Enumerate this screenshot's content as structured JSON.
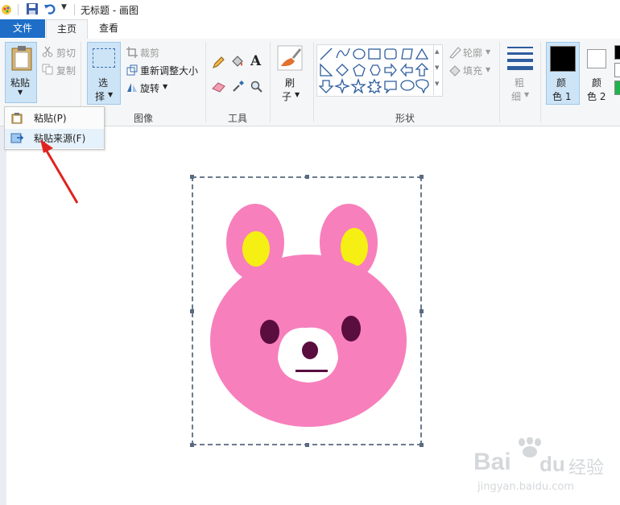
{
  "window": {
    "title": "无标题 - 画图"
  },
  "tabs": {
    "file": "文件",
    "home": "主页",
    "view": "查看"
  },
  "clipboard": {
    "paste_label": "粘贴",
    "cut_label": "剪切",
    "copy_label": "复制"
  },
  "image": {
    "select_top": "选",
    "select_bottom": "择",
    "crop_label": "裁剪",
    "resize_label": "重新调整大小",
    "rotate_label": "旋转",
    "group_label": "图像"
  },
  "tools": {
    "group_label": "工具"
  },
  "brush": {
    "top": "刷",
    "bottom": "子"
  },
  "shapes": {
    "outline_label": "轮廓",
    "fill_label": "填充",
    "group_label": "形状"
  },
  "size": {
    "top": "粗",
    "bottom": "细"
  },
  "colors": {
    "color1_top": "颜",
    "color1_bottom": "色 1",
    "color2_top": "颜",
    "color2_bottom": "色 2",
    "color1_value": "#000000",
    "color2_value": "#ffffff"
  },
  "paste_menu": {
    "paste": "粘贴(P)",
    "paste_from": "粘贴来源(F)"
  },
  "watermark": {
    "brand": "Bai",
    "brand2": "du",
    "cn": "经验",
    "url": "jingyan.baidu.com"
  },
  "accent": "#1e6ec8",
  "illustration": "pink-bunny-face"
}
